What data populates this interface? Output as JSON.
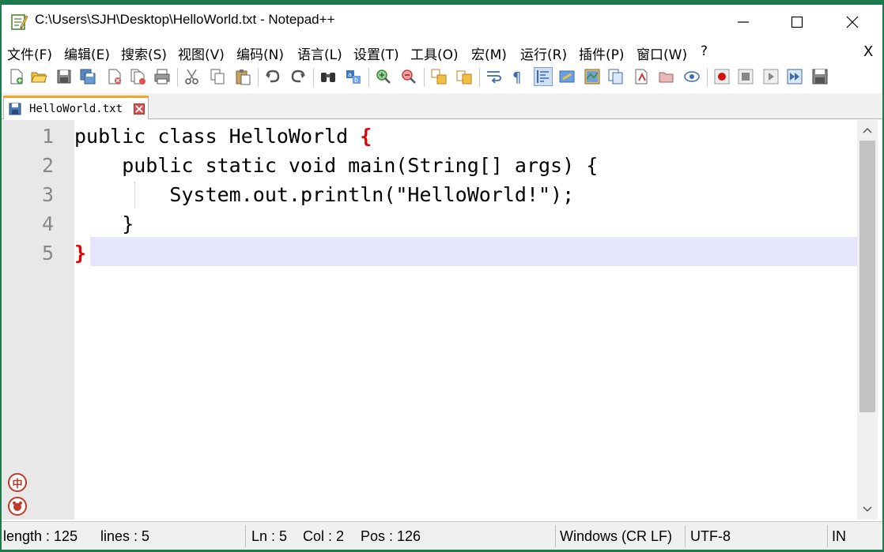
{
  "window": {
    "title": "C:\\Users\\SJH\\Desktop\\HelloWorld.txt - Notepad++"
  },
  "menu": {
    "items": [
      "文件(F)",
      "编辑(E)",
      "搜索(S)",
      "视图(V)",
      "编码(N)",
      "语言(L)",
      "设置(T)",
      "工具(O)",
      "宏(M)",
      "运行(R)",
      "插件(P)",
      "窗口(W)",
      "?"
    ],
    "close_label": "X"
  },
  "toolbar": {
    "icons": [
      "new-file-icon",
      "open-file-icon",
      "save-icon",
      "save-all-icon",
      "close-icon",
      "close-all-icon",
      "print-icon",
      "cut-icon",
      "copy-icon",
      "paste-icon",
      "undo-icon",
      "redo-icon",
      "find-icon",
      "replace-icon",
      "zoom-in-icon",
      "zoom-out-icon",
      "sync-vertical-icon",
      "sync-horizontal-icon",
      "word-wrap-icon",
      "show-all-chars-icon",
      "indent-guide-icon",
      "user-defined-lang-icon",
      "doc-map-icon",
      "function-list-icon",
      "folder-as-workspace-icon",
      "monitoring-icon",
      "record-macro-icon",
      "stop-recording-icon",
      "play-macro-icon",
      "run-macro-multiple-icon",
      "save-macro-icon"
    ]
  },
  "tabs": [
    {
      "label": "HelloWorld.txt"
    }
  ],
  "editor": {
    "line_numbers": [
      "1",
      "2",
      "3",
      "4",
      "5"
    ],
    "lines": [
      {
        "pre": "public class HelloWorld ",
        "brace": "{",
        "post": ""
      },
      {
        "pre": "    public static void main(String[] args) {",
        "brace": "",
        "post": ""
      },
      {
        "pre": "        System.out.println(\"HelloWorld!\");",
        "brace": "",
        "post": ""
      },
      {
        "pre": "    }",
        "brace": "",
        "post": ""
      },
      {
        "pre": "",
        "brace": "}",
        "post": ""
      }
    ],
    "current_line": 5
  },
  "ime": {
    "mode_label": "中"
  },
  "status": {
    "length": "length : 125",
    "lines": "lines : 5",
    "ln": "Ln : 5",
    "col": "Col : 2",
    "pos": "Pos : 126",
    "eol": "Windows (CR LF)",
    "encoding": "UTF-8",
    "insert_mode": "IN"
  },
  "colors": {
    "brace_match": "#e00000",
    "current_line": "#e6e6fa",
    "tab_accent": "#f5a623",
    "desktop_bg": "#1e7a4c"
  }
}
